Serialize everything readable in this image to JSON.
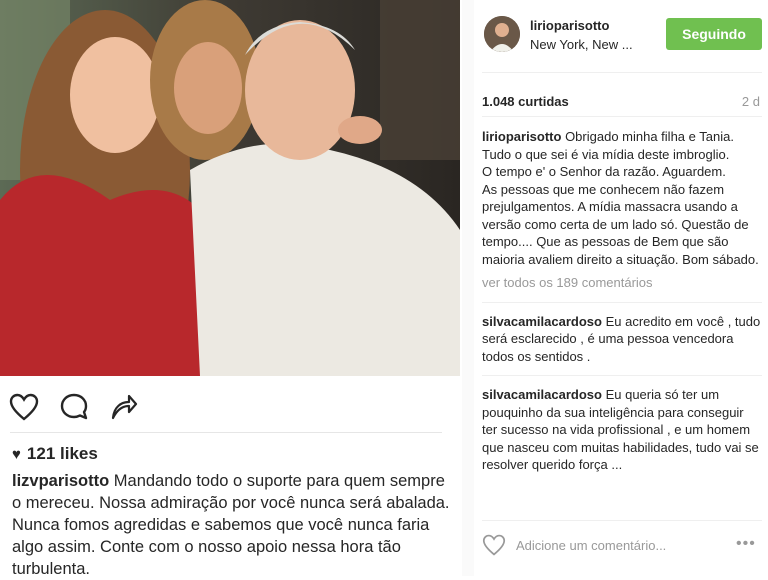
{
  "post": {
    "likes": "121 likes",
    "caption_user": "lizvparisotto",
    "caption_text": " Mandando todo o suporte para quem sempre o mereceu. Nossa admiração por você nunca será abalada. Nunca fomos agredidas e sabemos que você nunca faria algo assim. Conte com o nosso apoio nessa hora tão turbulenta."
  },
  "panel": {
    "username": "lirioparisotto",
    "location": "New York, New ...",
    "follow_label": "Seguindo",
    "likes_count": "1.048 curtidas",
    "age": "2 d",
    "main_comment": {
      "user": "lirioparisotto",
      "lines": [
        " Obrigado minha filha e Tania. Tudo o que sei é via mídia deste imbroglio.",
        "O tempo e' o Senhor da razão. Aguardem.",
        "As pessoas que me conhecem não fazem prejulgamentos. A mídia massacra usando a versão como certa de um lado só. Questão de tempo.... Que as pessoas de Bem que são maioria avaliem direito a situação. Bom sábado."
      ]
    },
    "view_all": "ver todos os 189 comentários",
    "comments": [
      {
        "user": "silvacamilacardoso",
        "text": " Eu acredito em você , tudo será esclarecido , é uma pessoa vencedora todos os sentidos ."
      },
      {
        "user": "silvacamilacardoso",
        "text": " Eu queria só ter um pouquinho da sua inteligência para conseguir ter sucesso na vida profissional , e um homem que nasceu com muitas habilidades, tudo vai se resolver querido força ..."
      }
    ],
    "comment_placeholder": "Adicione um comentário...",
    "more": "•••"
  },
  "icons": {
    "like": "heart-outline-icon",
    "comment": "speech-bubble-icon",
    "share": "share-arrow-icon"
  },
  "colors": {
    "follow_bg": "#70c050",
    "muted": "#999999"
  }
}
